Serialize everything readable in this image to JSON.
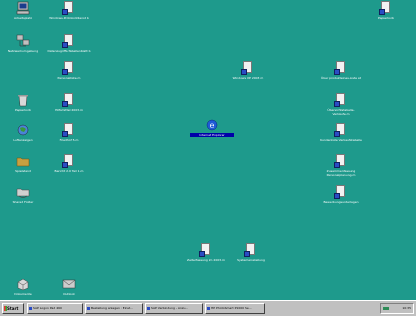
{
  "desktop": {
    "background": "#1e9a8c",
    "icons": [
      {
        "name": "arbeitsplatz-icon",
        "label": "Arbeitsplatz"
      },
      {
        "name": "protokolldienst-icon",
        "label": "Windows-Protokolldienst b"
      },
      {
        "name": "papierkorb-icon",
        "label": "Papierkorb"
      },
      {
        "name": "netzwerkumgebung-icon",
        "label": "Netzwerkumgebung"
      },
      {
        "name": "datenzugriffs-tabellenblatt-icon",
        "label": "Datenzugriffs-Tabellenblatt b"
      },
      {
        "name": "personalliste-icon",
        "label": "Personalliste.m"
      },
      {
        "name": "windowsxp-icon",
        "label": "Windows XP 2003 m"
      },
      {
        "name": "ueber-produkte-icon",
        "label": "Über produkteines-Liste at"
      },
      {
        "name": "papierkorb2-icon",
        "label": "Papierkorb"
      },
      {
        "name": "hilfsmittel-icon",
        "label": "Hilfsmittel 2003.m"
      },
      {
        "name": "obersichtstabelle-icon",
        "label": "Übersichtstabelle-Verkäufe.m"
      },
      {
        "name": "internet-explorer-icon",
        "label": "Internet Explorer"
      },
      {
        "name": "lufttabelle-icon",
        "label": "Luftanzeigen"
      },
      {
        "name": "friedhof-icon",
        "label": "Friedhof 5.m"
      },
      {
        "name": "kundenliste-icon",
        "label": "Kundenliste Verkaufstabelle"
      },
      {
        "name": "spielstand-icon",
        "label": "Spielstand"
      },
      {
        "name": "bericht-icon",
        "label": "Bericht 2.0 Teil 1.m"
      },
      {
        "name": "zusammenfassung-icon",
        "label": "Zusammenfassung Personalplanung.m"
      },
      {
        "name": "shared-folder-icon",
        "label": "Shared Folder"
      },
      {
        "name": "bewerbung-icon",
        "label": "Bewerbungsunterlagen"
      },
      {
        "name": "zeiterfassung-icon",
        "label": "Zeiterfassung im 2003.m"
      },
      {
        "name": "systemeinstellung-icon",
        "label": "Systemeinstellung"
      },
      {
        "name": "dokumentenbox-icon",
        "label": "Dokumente"
      },
      {
        "name": "outlook-icon",
        "label": "Outlook"
      }
    ]
  },
  "taskbar": {
    "start_label": "Start",
    "tasks": [
      "SAP Logon Pad 460",
      "Bestellung anlegen : Einst...",
      "SAP Verbindung - Anzu...",
      "HP PhotoSmart P1000 Se..."
    ],
    "clock": "10:35"
  }
}
